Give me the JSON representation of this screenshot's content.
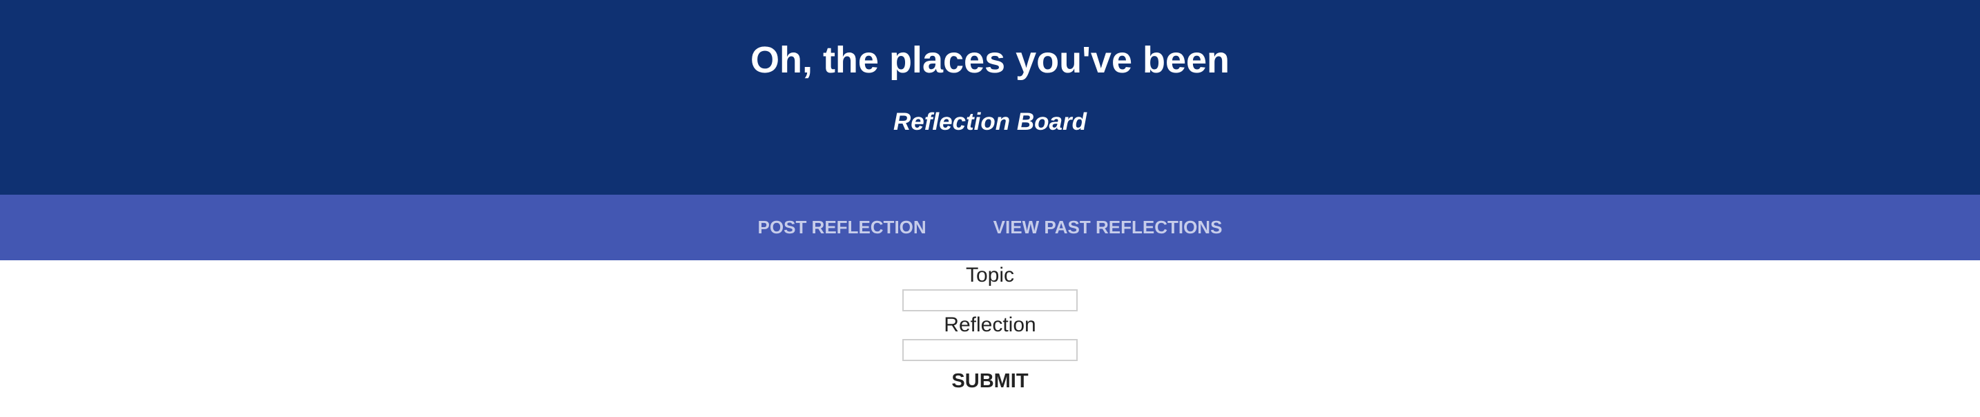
{
  "header": {
    "title": "Oh, the places you've been",
    "subtitle": "Reflection Board"
  },
  "nav": {
    "items": [
      {
        "label": "POST REFLECTION"
      },
      {
        "label": "VIEW PAST REFLECTIONS"
      }
    ]
  },
  "form": {
    "topic_label": "Topic",
    "topic_value": "",
    "reflection_label": "Reflection",
    "reflection_value": "",
    "submit_label": "SUBMIT"
  },
  "colors": {
    "header_bg": "#0f3172",
    "nav_bg": "#4357b2",
    "nav_text": "#c7cdea"
  }
}
